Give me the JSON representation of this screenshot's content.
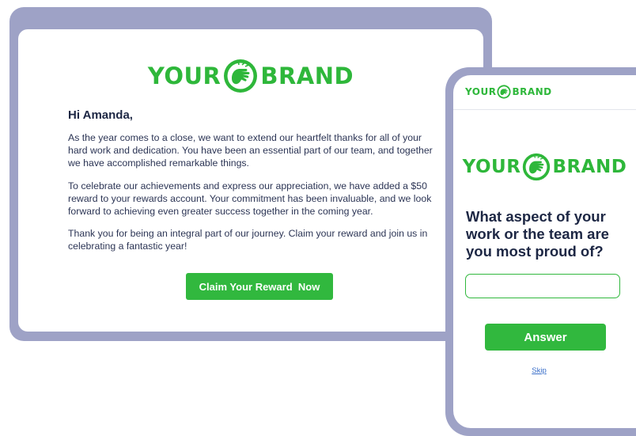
{
  "brand": {
    "word_left": "YOUR",
    "word_right": "BRAND",
    "mark_icon": "pointing-hand-icon",
    "color": "#2eb73a"
  },
  "email": {
    "greeting": "Hi Amanda,",
    "paragraphs": [
      "As the year comes to a close, we want to extend our heartfelt thanks for all of your hard work and dedication. You have been an essential part of our team, and together we have accomplished remarkable things.",
      "To celebrate our achievements and express our appreciation, we have added a $50 reward to your rewards account. Your commitment has been invaluable, and we look forward to achieving even greater success together in the coming year.",
      "Thank you for being an integral part of our journey. Claim your reward and join us in celebrating a fantastic year!"
    ],
    "cta_label": "Claim Your Reward  Now"
  },
  "phone": {
    "question": "What aspect of your work or the team are you most proud of?",
    "input_value": "",
    "answer_label": "Answer",
    "skip_label": "Skip"
  },
  "colors": {
    "frame": "#9ea2c6",
    "accent_green": "#31b83e",
    "text_dark": "#1d2744",
    "link_blue": "#3a6fc9"
  }
}
